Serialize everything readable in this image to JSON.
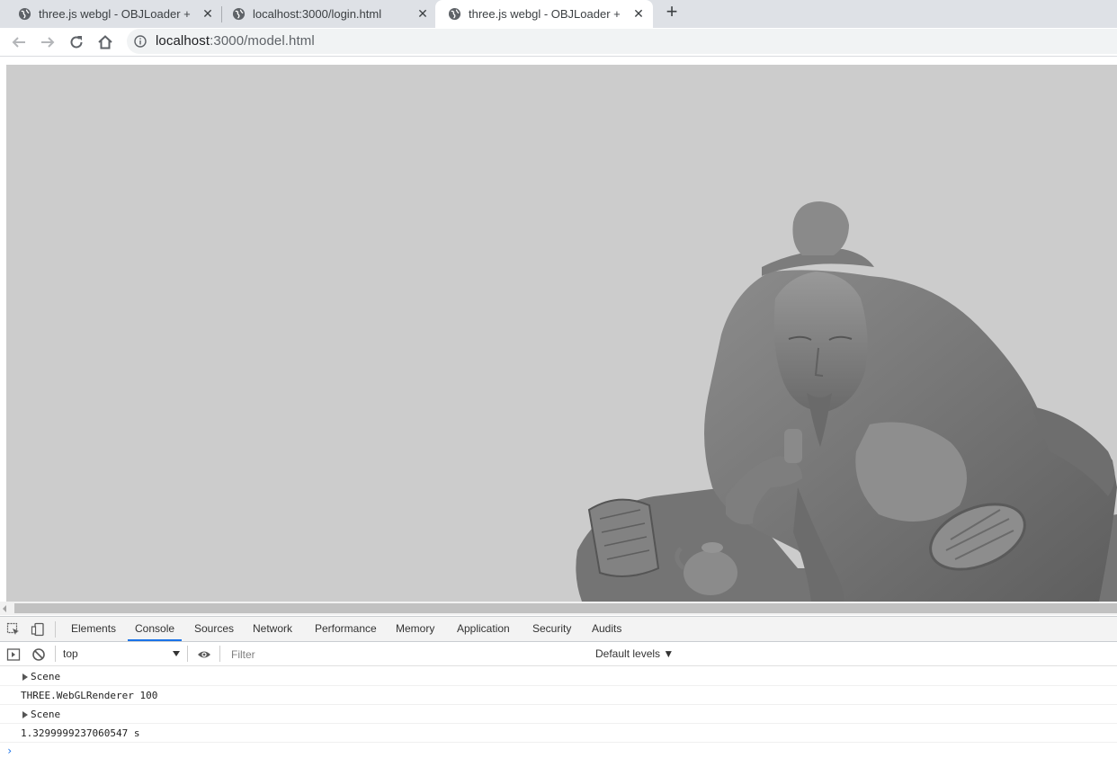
{
  "browser": {
    "tabs": [
      {
        "title": "three.js webgl - OBJLoader + MTLLoader",
        "active": false,
        "favicon": "globe-icon"
      },
      {
        "title": "localhost:3000/login.html",
        "active": false,
        "favicon": "globe-icon"
      },
      {
        "title": "three.js webgl - OBJLoader + MTLLoader",
        "active": true,
        "favicon": "globe-icon"
      }
    ],
    "new_tab_symbol": "+",
    "close_symbol": "✕",
    "address": {
      "host": "localhost",
      "path": ":3000/model.html"
    }
  },
  "viewport": {
    "canvas_color": "#cccccc",
    "model_color": "#7a7a7a",
    "model_description_icon": "statue-model"
  },
  "devtools": {
    "panel_tabs": [
      "Elements",
      "Console",
      "Sources",
      "Network",
      "Performance",
      "Memory",
      "Application",
      "Security",
      "Audits"
    ],
    "active_tab": "Console",
    "context": "top",
    "filter_placeholder": "Filter",
    "levels_label": "Default levels ▼",
    "console_lines": [
      {
        "text": "Scene",
        "expandable": true
      },
      {
        "text": "THREE.WebGLRenderer 100",
        "expandable": false
      },
      {
        "text": "Scene",
        "expandable": true
      },
      {
        "text": "1.3299999237060547 s",
        "expandable": false
      }
    ],
    "prompt_symbol": "›"
  },
  "colors": {
    "accent": "#1a73e8",
    "tab_strip": "#dee1e6"
  }
}
